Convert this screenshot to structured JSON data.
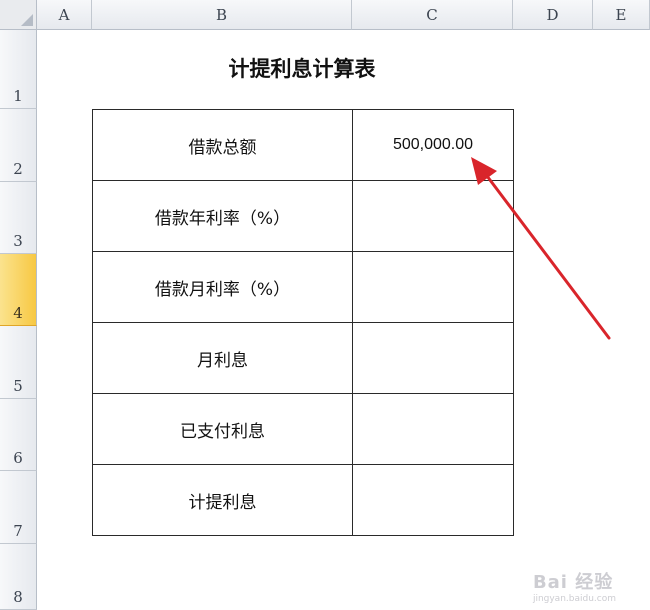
{
  "columns": [
    "A",
    "B",
    "C",
    "D",
    "E"
  ],
  "rows": [
    "1",
    "2",
    "3",
    "4",
    "5",
    "6",
    "7",
    "8"
  ],
  "selected_row": "4",
  "sheet": {
    "title": "计提利息计算表",
    "table": [
      {
        "label": "借款总额",
        "value": "500,000.00"
      },
      {
        "label": "借款年利率（%）",
        "value": ""
      },
      {
        "label": "借款月利率（%）",
        "value": ""
      },
      {
        "label": "月利息",
        "value": ""
      },
      {
        "label": "已支付利息",
        "value": ""
      },
      {
        "label": "计提利息",
        "value": ""
      }
    ]
  },
  "annotation": {
    "arrow_color": "#d9252b"
  },
  "watermark": {
    "text": "Bai 经验",
    "sub": "jingyan.baidu.com"
  },
  "colors": {
    "header_bg": "#e6e9ee",
    "selected_header": "#f7c843",
    "grid_border": "#2a2a2a"
  }
}
